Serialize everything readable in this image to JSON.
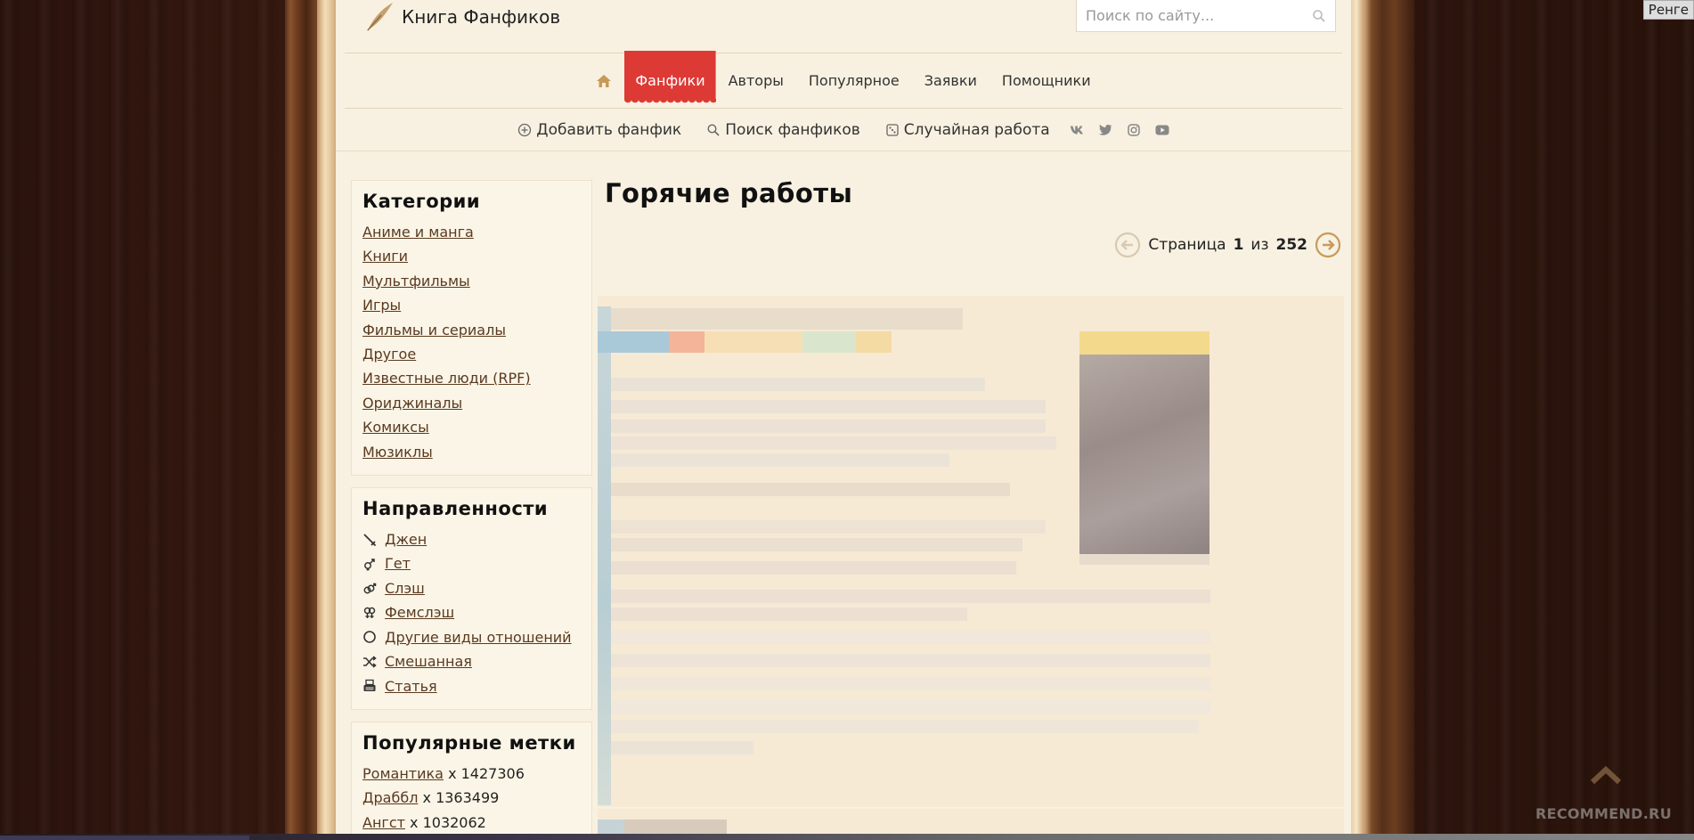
{
  "header": {
    "logo_text": "Книга Фанфиков",
    "search_placeholder": "Поиск по сайту..."
  },
  "nav": {
    "items": [
      "Фанфики",
      "Авторы",
      "Популярное",
      "Заявки",
      "Помощники"
    ],
    "active": "Фанфики"
  },
  "subnav": {
    "add": "Добавить фанфик",
    "search": "Поиск фанфиков",
    "random": "Случайная работа"
  },
  "sidebar": {
    "categories_title": "Категории",
    "categories": [
      "Аниме и манга",
      "Книги",
      "Мультфильмы",
      "Игры",
      "Фильмы и сериалы",
      "Другое",
      "Известные люди (RPF)",
      "Ориджиналы",
      "Комиксы",
      "Мюзиклы"
    ],
    "directions_title": "Направленности",
    "directions": [
      "Джен",
      "Гет",
      "Слэш",
      "Фемслэш",
      "Другие виды отношений",
      "Смешанная",
      "Статья"
    ],
    "tags_title": "Популярные метки",
    "tags": [
      {
        "label": "Романтика",
        "count": "x 1427306"
      },
      {
        "label": "Драббл",
        "count": "x 1363499"
      },
      {
        "label": "Ангст",
        "count": "x 1032062"
      }
    ]
  },
  "main": {
    "title": "Горячие работы",
    "pager": {
      "prefix": "Страница",
      "current": "1",
      "sep": "из",
      "total": "252"
    }
  },
  "overlay": {
    "renge": "Ренге",
    "watermark": "RECOMMEND.RU"
  },
  "colors": {
    "accent": "#dd3a36",
    "link": "#5a3a20",
    "gold": "#c69a58",
    "page_bg": "#f8f1e1"
  }
}
